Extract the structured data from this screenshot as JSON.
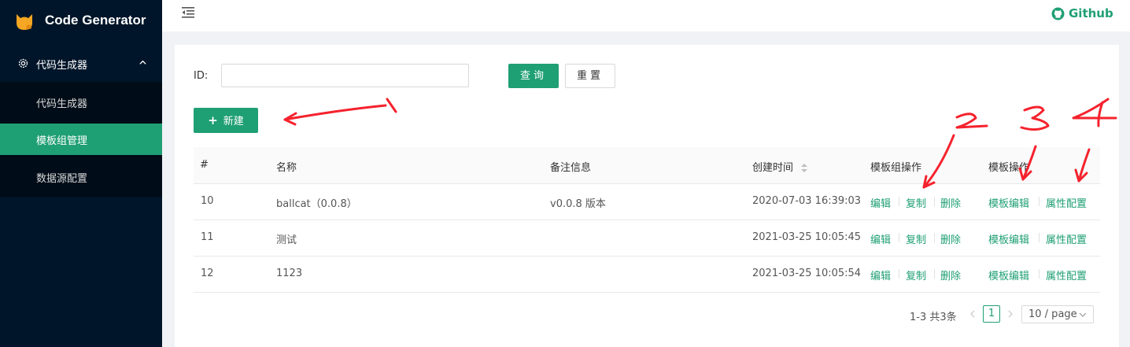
{
  "app": {
    "title": "Code Generator"
  },
  "sidebar": {
    "parent_label": "代码生成器",
    "items": [
      {
        "label": "代码生成器",
        "active": false
      },
      {
        "label": "模板组管理",
        "active": true
      },
      {
        "label": "数据源配置",
        "active": false
      }
    ]
  },
  "header": {
    "github_label": "Github"
  },
  "search": {
    "id_label": "ID:",
    "id_value": "",
    "query_label": "查询",
    "reset_label": "重置"
  },
  "toolbar": {
    "new_icon": "+",
    "new_label": "新建"
  },
  "table": {
    "columns": [
      "#",
      "名称",
      "备注信息",
      "创建时间",
      "模板组操作",
      "模板操作"
    ],
    "rows": [
      {
        "id": "10",
        "name": "ballcat（0.0.8）",
        "remark": "v0.0.8 版本",
        "created": "2020-07-03 16:39:03"
      },
      {
        "id": "11",
        "name": "测试",
        "remark": "",
        "created": "2021-03-25 10:05:45"
      },
      {
        "id": "12",
        "name": "1123",
        "remark": "",
        "created": "2021-03-25 10:05:54"
      }
    ],
    "group_actions": [
      "编辑",
      "复制",
      "删除"
    ],
    "template_actions": [
      "模板编辑",
      "属性配置"
    ]
  },
  "pagination": {
    "total": "1-3 共3条",
    "current_page": "1",
    "page_size": "10 / page"
  },
  "colors": {
    "accent": "#1f9f74",
    "sidebar_bg": "#001529",
    "annotation": "#f5222d"
  },
  "icons": [
    "cat-logo-icon",
    "gear-icon",
    "chevron-up-icon",
    "menu-fold-icon",
    "github-icon",
    "plus-icon",
    "sort-icon",
    "chevron-left-icon",
    "chevron-right-icon",
    "chevron-down-icon"
  ]
}
